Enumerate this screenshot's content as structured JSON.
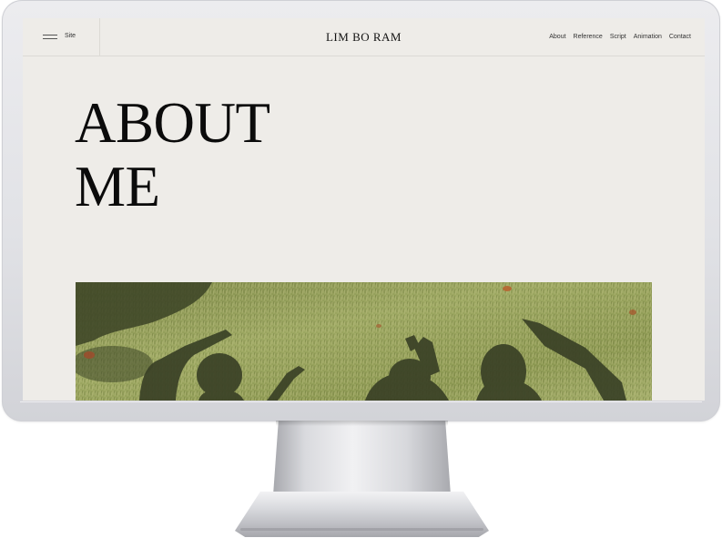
{
  "site": {
    "menu_label": "Site",
    "brand": "LIM BO RAM",
    "nav": [
      "About",
      "Reference",
      "Script",
      "Animation",
      "Contact"
    ]
  },
  "hero": {
    "title_line1": "ABOUT",
    "title_line2": "ME"
  },
  "colors": {
    "screen_bg": "#eeece8",
    "text": "#0b0b0b",
    "grass": "#8f9a55",
    "shadow": "#3b4228"
  },
  "icons": {
    "menu": "hamburger-icon"
  }
}
